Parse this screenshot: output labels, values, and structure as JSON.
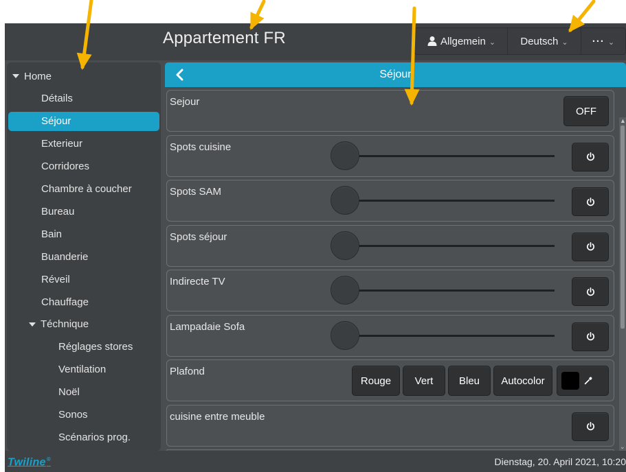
{
  "header": {
    "title": "Appartement FR",
    "user_label": "Allgemein",
    "language_label": "Deutsch",
    "more_label": "···"
  },
  "sidebar": {
    "items": [
      {
        "label": "Home",
        "level": 0,
        "expanded": true,
        "active": false
      },
      {
        "label": "Détails",
        "level": 1,
        "active": false
      },
      {
        "label": "Séjour",
        "level": 1,
        "active": true
      },
      {
        "label": "Exterieur",
        "level": 1,
        "active": false
      },
      {
        "label": "Corridores",
        "level": 1,
        "active": false
      },
      {
        "label": "Chambre à coucher",
        "level": 1,
        "active": false
      },
      {
        "label": "Bureau",
        "level": 1,
        "active": false
      },
      {
        "label": "Bain",
        "level": 1,
        "active": false
      },
      {
        "label": "Buanderie",
        "level": 1,
        "active": false
      },
      {
        "label": "Réveil",
        "level": 1,
        "active": false
      },
      {
        "label": "Chauffage",
        "level": 1,
        "active": false
      },
      {
        "label": "Téchnique",
        "level": 1,
        "expanded": true,
        "active": false
      },
      {
        "label": "Réglages stores",
        "level": 2,
        "active": false
      },
      {
        "label": "Ventilation",
        "level": 2,
        "active": false
      },
      {
        "label": "Noël",
        "level": 2,
        "active": false
      },
      {
        "label": "Sonos",
        "level": 2,
        "active": false
      },
      {
        "label": "Scénarios prog.",
        "level": 2,
        "active": false
      }
    ]
  },
  "page": {
    "title": "Séjour"
  },
  "devices": [
    {
      "label": "Sejour",
      "type": "toggle",
      "state_label": "OFF"
    },
    {
      "label": "Spots cuisine",
      "type": "dimmer",
      "level": 0,
      "power_icon": "power-icon"
    },
    {
      "label": "Spots SAM",
      "type": "dimmer",
      "level": 0,
      "power_icon": "power-icon"
    },
    {
      "label": "Spots séjour",
      "type": "dimmer",
      "level": 0,
      "power_icon": "power-icon"
    },
    {
      "label": "Indirecte TV",
      "type": "dimmer",
      "level": 0,
      "power_icon": "power-icon"
    },
    {
      "label": "Lampadaie Sofa",
      "type": "dimmer",
      "level": 0,
      "power_icon": "power-icon"
    },
    {
      "label": "Plafond",
      "type": "color",
      "buttons": [
        "Rouge",
        "Vert",
        "Bleu",
        "Autocolor"
      ],
      "current_color": "#000000",
      "picker_icon": "eyedropper-icon"
    },
    {
      "label": "cuisine entre meuble",
      "type": "switch",
      "power_icon": "power-icon"
    }
  ],
  "footer": {
    "brand": "Twiline",
    "brand_mark": "®",
    "datetime": "Dienstag, 20. April 2021, 10:20"
  },
  "colors": {
    "accent": "#1ba0c8",
    "background": "#4a4d50",
    "annotation_arrow": "#f5b400"
  }
}
